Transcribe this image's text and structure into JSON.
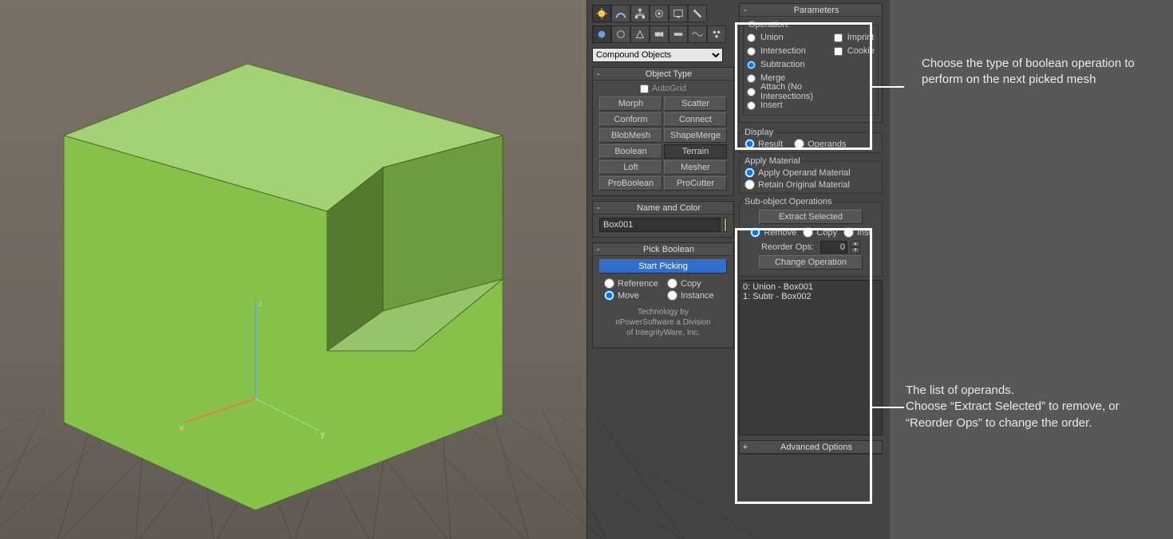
{
  "dropdown_selected": "Compound Objects",
  "rollouts": {
    "object_type": {
      "title": "Object Type",
      "autogrid": "AutoGrid",
      "buttons": [
        "Morph",
        "Scatter",
        "Conform",
        "Connect",
        "BlobMesh",
        "ShapeMerge",
        "Boolean",
        "Terrain",
        "Loft",
        "Mesher",
        "ProBoolean",
        "ProCutter"
      ],
      "pressed": "Terrain"
    },
    "name_color": {
      "title": "Name and Color",
      "value": "Box001",
      "swatch": "#86c24a"
    },
    "pick_boolean": {
      "title": "Pick Boolean",
      "start": "Start Picking",
      "modes": [
        "Reference",
        "Copy",
        "Move",
        "Instance"
      ],
      "selected": "Move",
      "credit1": "Technology by",
      "credit2": "nPowerSoftware a Division",
      "credit3": "of IntegrityWare, Inc."
    },
    "parameters": {
      "title": "Parameters",
      "operation_legend": "Operation:",
      "ops": [
        "Union",
        "Intersection",
        "Subtraction",
        "Merge",
        "Attach (No Intersections)",
        "Insert"
      ],
      "op_selected": "Subtraction",
      "imprint": "Imprint",
      "cookie": "Cookie"
    },
    "display": {
      "legend": "Display",
      "result": "Result",
      "operands": "Operands",
      "selected": "Result"
    },
    "apply_mat": {
      "legend": "Apply Material",
      "opts": [
        "Apply Operand Material",
        "Retain Original Material"
      ],
      "selected": "Apply Operand Material"
    },
    "subobj": {
      "legend": "Sub-object Operations",
      "extract": "Extract Selected",
      "modes": [
        "Remove",
        "Copy",
        "Inst"
      ],
      "mode_selected": "Remove",
      "reorder_label": "Reorder Ops:",
      "reorder_value": "0",
      "change": "Change Operation",
      "list": [
        "0: Union - Box001",
        "1: Subtr - Box002"
      ]
    },
    "advanced": {
      "title": "Advanced Options"
    }
  },
  "annotations": {
    "top": "Choose the type of boolean operation to perform on the next picked mesh",
    "bottom": "The list of operands.\nChoose “Extract Selected” to remove, or “Reorder Ops” to change the order."
  }
}
